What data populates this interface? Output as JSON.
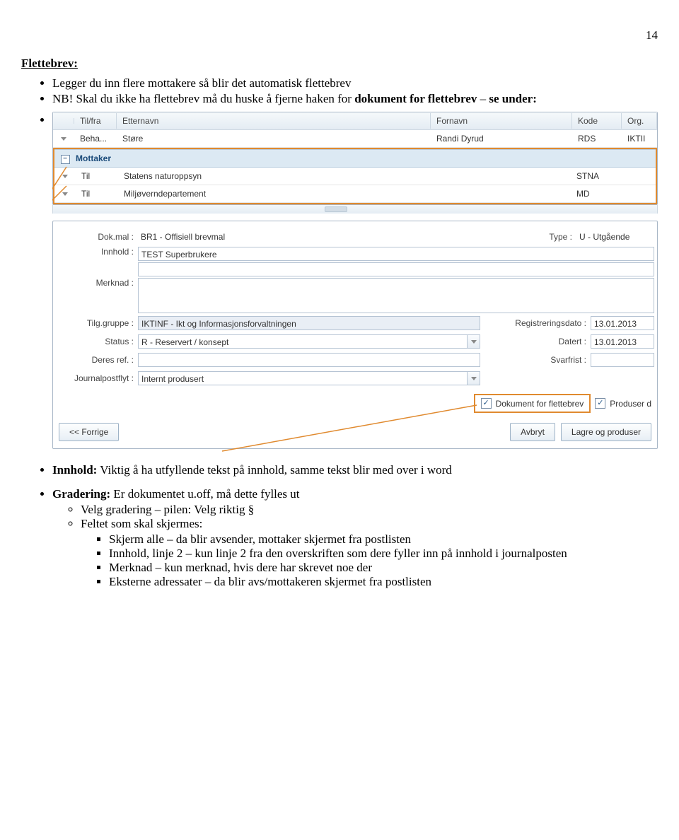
{
  "page_number": "14",
  "section_title": "Flettebrev:",
  "bullet1": "Legger du inn flere mottakere så blir det automatisk flettebrev",
  "bullet2_pre": "NB! Skal du ikke ha flettebrev må du huske å fjerne haken for ",
  "bullet2_bold1": "dokument for flettebrev",
  "bullet2_mid": " – ",
  "bullet2_bold2": "se under:",
  "bullet3_label": "Innhold:",
  "bullet3_text": " Viktig å ha utfyllende tekst på innhold, samme tekst blir med over i word",
  "bullet4_label": "Gradering:",
  "bullet4_text": " Er dokumentet u.off, må dette fylles ut",
  "sub4a": "Velg gradering – pilen: Velg riktig §",
  "sub4b": "Feltet som skal skjermes:",
  "sq1": "Skjerm alle – da blir avsender, mottaker skjermet fra postlisten",
  "sq2": "Innhold, linje 2 – kun linje 2 fra den overskriften som dere fyller inn på innhold i journalposten",
  "sq3": "Merknad – kun merknad, hvis dere har skrevet noe der",
  "sq4": "Eksterne adressater – da blir avs/mottakeren skjermet fra postlisten",
  "screenshot": {
    "headers": {
      "tilfra": "Til/fra",
      "etternavn": "Etternavn",
      "fornavn": "Fornavn",
      "kode": "Kode",
      "org": "Org."
    },
    "row_beha": {
      "tilfra": "Beha...",
      "etternavn": "Støre",
      "fornavn": "Randi Dyrud",
      "kode": "RDS",
      "org": "IKTII"
    },
    "cat_mottaker": "Mottaker",
    "row_til1": {
      "tilfra": "Til",
      "etternavn": "Statens naturoppsyn",
      "kode": "STNA"
    },
    "row_til2": {
      "tilfra": "Til",
      "etternavn": "Miljøverndepartement",
      "kode": "MD"
    },
    "form": {
      "dokmal_label": "Dok.mal :",
      "dokmal_value": "BR1 - Offisiell brevmal",
      "type_label": "Type :",
      "type_value": "U - Utgående",
      "innhold_label": "Innhold :",
      "innhold_value": "TEST Superbrukere",
      "merknad_label": "Merknad :",
      "tilggruppe_label": "Tilg.gruppe :",
      "tilggruppe_value": "IKTINF - Ikt og Informasjonsforvaltningen",
      "regdato_label": "Registreringsdato :",
      "regdato_value": "13.01.2013",
      "status_label": "Status :",
      "status_value": "R - Reservert / konsept",
      "datert_label": "Datert :",
      "datert_value": "13.01.2013",
      "deresref_label": "Deres ref. :",
      "svarfrist_label": "Svarfrist :",
      "jpflyt_label": "Journalpostflyt :",
      "jpflyt_value": "Internt produsert",
      "chk_flettebrev": "Dokument for flettebrev",
      "chk_produser": "Produser d",
      "btn_forrige": "<< Forrige",
      "btn_avbryt": "Avbryt",
      "btn_lagre": "Lagre og produser"
    }
  }
}
